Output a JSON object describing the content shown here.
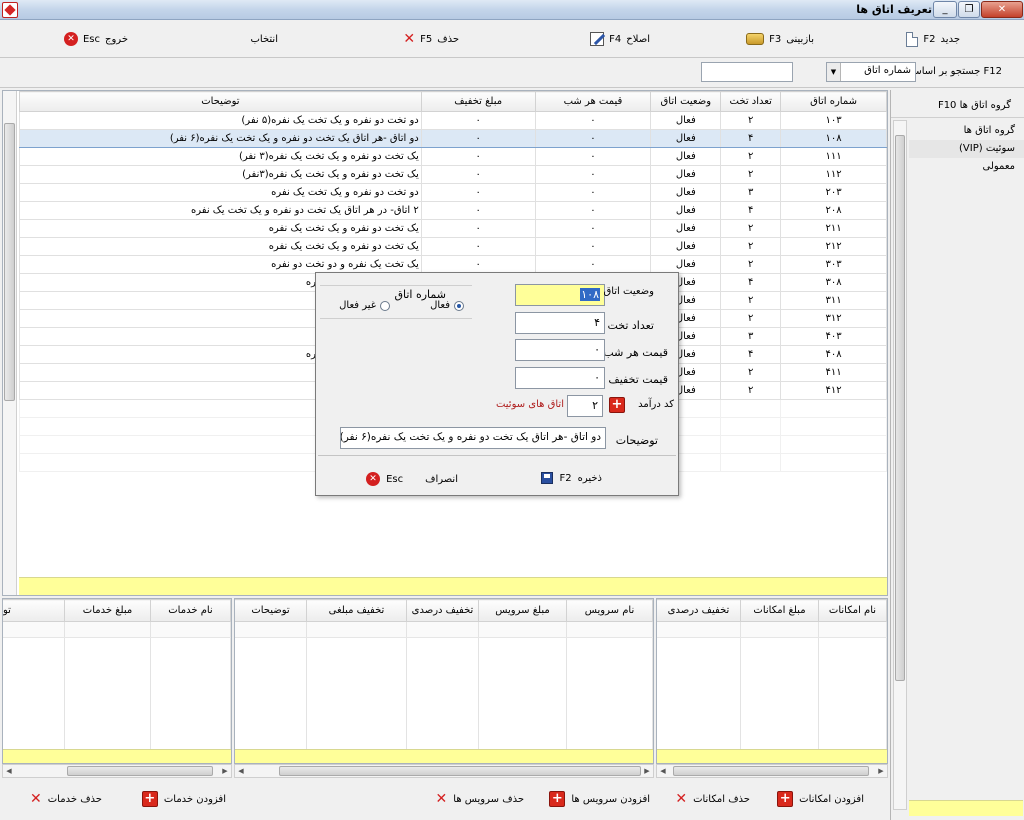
{
  "window": {
    "title": "تعریف اتاق ها"
  },
  "toolbar": {
    "new_label": "جدید",
    "new_key": "F2",
    "refresh_label": "بازبینی",
    "refresh_key": "F3",
    "edit_label": "اصلاح",
    "edit_key": "F4",
    "delete_label": "حذف",
    "delete_key": "F5",
    "select_label": "انتخاب",
    "exit_label": "خروج",
    "exit_key": "Esc"
  },
  "search": {
    "label": "F12 جستجو بر اساس :",
    "field_value": "شماره اتاق",
    "text_value": ""
  },
  "right_panel": {
    "header": "گروه اتاق ها  F10",
    "items": [
      {
        "label": "گروه اتاق ها"
      },
      {
        "label": "سوئیت (VIP)"
      },
      {
        "label": "معمولی"
      }
    ]
  },
  "grid": {
    "columns": {
      "room_no": "شماره اتاق",
      "beds": "تعداد تخت",
      "status": "وضعیت اتاق",
      "price": "قیمت هر شب",
      "discount": "مبلغ تخفیف",
      "desc": "توضیحات"
    },
    "rows": [
      {
        "room": "۱۰۳",
        "beds": "۲",
        "status": "فعال",
        "price": "۰",
        "discount": "۰",
        "desc": "دو تخت دو نفره و یک تخت یک نفره(۵ نفر)"
      },
      {
        "room": "۱۰۸",
        "beds": "۴",
        "status": "فعال",
        "price": "۰",
        "discount": "۰",
        "desc": "دو اتاق -هر اتاق یک تخت دو نفره و یک تخت یک نفره(۶ نفر)"
      },
      {
        "room": "۱۱۱",
        "beds": "۲",
        "status": "فعال",
        "price": "۰",
        "discount": "۰",
        "desc": "یک تخت دو نفره و یک تخت یک نفره(۳ نفر)"
      },
      {
        "room": "۱۱۲",
        "beds": "۲",
        "status": "فعال",
        "price": "۰",
        "discount": "۰",
        "desc": "یک تخت دو نفره و یک تخت یک نفره(۳نفر)"
      },
      {
        "room": "۲۰۳",
        "beds": "۳",
        "status": "فعال",
        "price": "۰",
        "discount": "۰",
        "desc": "دو تخت دو نفره و یک تخت یک نفره"
      },
      {
        "room": "۲۰۸",
        "beds": "۴",
        "status": "فعال",
        "price": "۰",
        "discount": "۰",
        "desc": "۲ اتاق-  در هر اتاق یک تخت دو نفره و یک تخت یک نفره"
      },
      {
        "room": "۲۱۱",
        "beds": "۲",
        "status": "فعال",
        "price": "۰",
        "discount": "۰",
        "desc": "یک تخت دو نفره و یک تخت یک نفره"
      },
      {
        "room": "۲۱۲",
        "beds": "۲",
        "status": "فعال",
        "price": "۰",
        "discount": "۰",
        "desc": "یک تخت دو نفره و یک تخت یک نفره"
      },
      {
        "room": "۳۰۳",
        "beds": "۲",
        "status": "فعال",
        "price": "۰",
        "discount": "۰",
        "desc": "یک تخت یک نفره و دو تخت دو نفره"
      },
      {
        "room": "۳۰۸",
        "beds": "۴",
        "status": "فعال",
        "price": "۰",
        "discount": "۰",
        "desc": "دو نفره و یک تخت یک نفره"
      },
      {
        "room": "۳۱۱",
        "beds": "۲",
        "status": "فعال",
        "price": "۰",
        "discount": "۰",
        "desc": "یک تخت یک نفره"
      },
      {
        "room": "۳۱۲",
        "beds": "۲",
        "status": "فعال",
        "price": "۰",
        "discount": "۰",
        "desc": "یک تخت یک نفره"
      },
      {
        "room": "۴۰۳",
        "beds": "۳",
        "status": "فعال",
        "price": "۰",
        "discount": "۰",
        "desc": "دو نفره"
      },
      {
        "room": "۴۰۸",
        "beds": "۴",
        "status": "فعال",
        "price": "۰",
        "discount": "۰",
        "desc": "دو نفره و یک تخت یک نفره"
      },
      {
        "room": "۴۱۱",
        "beds": "۲",
        "status": "فعال",
        "price": "۰",
        "discount": "۰",
        "desc": "یک تخت یک نفره"
      },
      {
        "room": "۴۱۲",
        "beds": "۲",
        "status": "فعال",
        "price": "۰",
        "discount": "۰",
        "desc": "یک نفره"
      }
    ]
  },
  "dialog": {
    "room_no_label": "شماره اتاق",
    "room_no_value": "۱۰۸",
    "beds_label": "تعداد تخت",
    "beds_value": "۴",
    "price_label": "قیمت هر شب",
    "price_value": "۰",
    "discount_label": "قیمت تخفیف",
    "discount_value": "۰",
    "income_code_label": "کد درآمد",
    "income_code_value": "۲",
    "income_code_name": "اتاق های سوئیت",
    "desc_label": "توضیحات",
    "desc_value": "دو اتاق -هر اتاق یک تخت دو نفره و یک تخت یک نفره(۶ نفر)",
    "status_label": "وضعیت اتاق",
    "active_label": "فعال",
    "inactive_label": "غیر فعال",
    "save_label": "ذخیره",
    "save_key": "F2",
    "cancel_label": "انصراف",
    "cancel_key": "Esc"
  },
  "facilities": {
    "columns": {
      "name": "نام امکانات",
      "amount": "مبلغ امکانات",
      "percent": "تخفیف درصدی"
    },
    "add_label": "افزودن امکانات",
    "delete_label": "حذف امکانات"
  },
  "services": {
    "columns": {
      "name": "نام سرویس",
      "amount": "مبلغ سرویس",
      "percent": "تخفیف درصدی",
      "amount_disc": "تخفیف مبلغی",
      "desc": "توضیحات"
    },
    "add_label": "افزودن سرویس ها",
    "delete_label": "حذف سرویس ها"
  },
  "amenities": {
    "columns": {
      "name": "نام خدمات",
      "amount": "مبلغ خدمات",
      "desc": "تو"
    },
    "add_label": "افزودن خدمات",
    "delete_label": "حذف خدمات"
  },
  "colors": {
    "selection": "#dce8f5",
    "yellow_row": "#ffff99",
    "accent_red": "#d42020"
  }
}
